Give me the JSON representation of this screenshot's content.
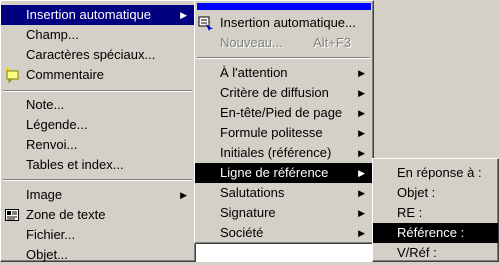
{
  "menu1": {
    "items": [
      {
        "label": "Insertion automatique",
        "arrow": "▶"
      },
      {
        "label": "Champ..."
      },
      {
        "label": "Caractères spéciaux..."
      },
      {
        "label": "Commentaire",
        "icon": "comment-icon"
      },
      {
        "label": "Note..."
      },
      {
        "label": "Légende..."
      },
      {
        "label": "Renvoi..."
      },
      {
        "label": "Tables et index..."
      },
      {
        "label": "Image",
        "arrow": "▶"
      },
      {
        "label": "Zone de texte",
        "icon": "textbox-icon"
      },
      {
        "label": "Fichier..."
      },
      {
        "label": "Objet..."
      }
    ]
  },
  "menu2": {
    "items": [
      {
        "label": "Insertion automatique...",
        "icon": "autotext-icon"
      },
      {
        "label": "Nouveau...",
        "shortcut": "Alt+F3",
        "disabled": true
      },
      {
        "label": "À l'attention",
        "arrow": "▶"
      },
      {
        "label": "Critère de diffusion",
        "arrow": "▶"
      },
      {
        "label": "En-tête/Pied de page",
        "arrow": "▶"
      },
      {
        "label": "Formule politesse",
        "arrow": "▶"
      },
      {
        "label": "Initiales (référence)",
        "arrow": "▶"
      },
      {
        "label": "Ligne de référence",
        "arrow": "▶"
      },
      {
        "label": "Salutations",
        "arrow": "▶"
      },
      {
        "label": "Signature",
        "arrow": "▶"
      },
      {
        "label": "Société",
        "arrow": "▶"
      }
    ]
  },
  "menu3": {
    "items": [
      {
        "label": "En réponse à :"
      },
      {
        "label": "Objet :"
      },
      {
        "label": "RE :"
      },
      {
        "label": "Référence :"
      },
      {
        "label": "V/Réf :"
      }
    ]
  },
  "colors": {
    "menu_bg": "#d4d0c8",
    "highlight": "#000080",
    "highlight_dark": "#000000",
    "accent_bar": "#0000ff"
  }
}
